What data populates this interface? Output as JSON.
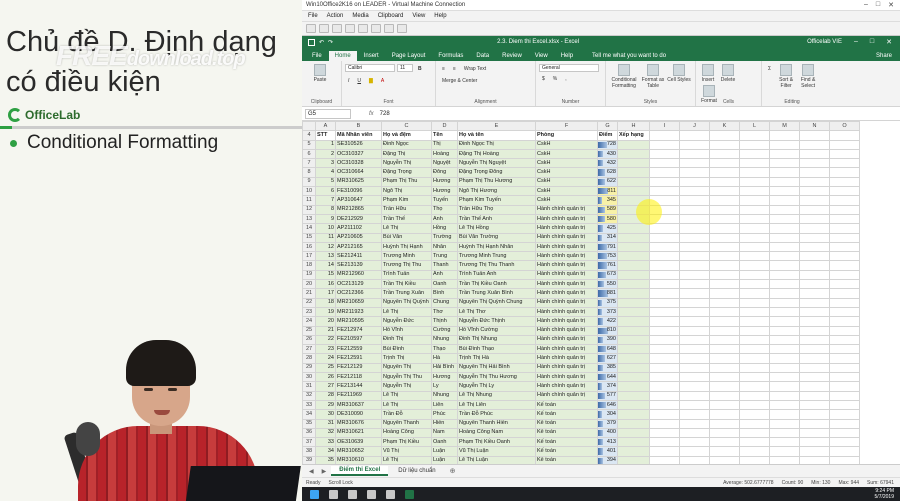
{
  "slide": {
    "title": "Chủ đề D. Định dạng có điều kiện",
    "watermark_1": "FREE",
    "watermark_2": "download.top",
    "logo_text": "OfficeLab",
    "bullet": "Conditional Formatting"
  },
  "vm": {
    "title": "Win10Office2K16 on LEADER - Virtual Machine Connection",
    "menu": [
      "File",
      "Action",
      "Media",
      "Clipboard",
      "View",
      "Help"
    ]
  },
  "excel": {
    "caption": "2.3. Diem thi Excel.xlsx - Excel",
    "user": "Officelab VIE",
    "tabs": [
      "File",
      "Home",
      "Insert",
      "Page Layout",
      "Formulas",
      "Data",
      "Review",
      "View",
      "Help"
    ],
    "active_tab": "Home",
    "tell_me": "Tell me what you want to do",
    "share": "Share",
    "ribbon": {
      "clipboard": {
        "label": "Clipboard",
        "paste": "Paste"
      },
      "font": {
        "label": "Font",
        "font_name": "Calibri",
        "font_size": "11"
      },
      "alignment": {
        "label": "Alignment",
        "wrap": "Wrap Text",
        "merge": "Merge & Center"
      },
      "number": {
        "label": "Number",
        "format": "General"
      },
      "styles": {
        "label": "Styles",
        "cond": "Conditional Formatting",
        "table": "Format as Table",
        "cell": "Cell Styles"
      },
      "cells": {
        "label": "Cells",
        "insert": "Insert",
        "delete": "Delete",
        "format": "Format"
      },
      "editing": {
        "label": "Editing",
        "sort": "Sort & Filter",
        "find": "Find & Select"
      }
    },
    "namebox": "G5",
    "fx": "fx",
    "formula": "728",
    "columns": [
      "A",
      "B",
      "C",
      "D",
      "E",
      "F",
      "G",
      "H",
      "I",
      "J",
      "K",
      "L",
      "M",
      "N",
      "O"
    ],
    "header_row": {
      "row": "4",
      "cells": [
        "STT",
        "Mã Nhân viên",
        "Họ và đệm",
        "Tên",
        "Họ và tên",
        "Phòng",
        "Điểm",
        "Xếp hạng"
      ]
    },
    "rows": [
      [
        "5",
        "1",
        "SE310526",
        "Đinh Ngọc",
        "Thị",
        "Đinh Ngọc Thị",
        "CskH",
        "728"
      ],
      [
        "6",
        "2",
        "OC310327",
        "Đặng Thị",
        "Hoàng",
        "Đặng Thị Hoàng",
        "CskH",
        "430"
      ],
      [
        "7",
        "3",
        "OC310328",
        "Nguyễn Thị",
        "Nguyệt",
        "Nguyễn Thị Nguyệt",
        "CskH",
        "432"
      ],
      [
        "8",
        "4",
        "OC310664",
        "Đặng Trọng",
        "Đông",
        "Đặng Trọng Đông",
        "CskH",
        "628"
      ],
      [
        "9",
        "5",
        "MR310625",
        "Phạm Thị Thu",
        "Hương",
        "Phạm Thị Thu Hương",
        "CskH",
        "622"
      ],
      [
        "10",
        "6",
        "FE310096",
        "Ngô Thị",
        "Hương",
        "Ngô Thị Hương",
        "CskH",
        "811"
      ],
      [
        "11",
        "7",
        "AP310647",
        "Phạm Kim",
        "Tuyến",
        "Phạm Kim Tuyến",
        "CskH",
        "345"
      ],
      [
        "12",
        "8",
        "MR212865",
        "Trần Hữu",
        "Thọ",
        "Trần Hữu Thọ",
        "Hành chính quản trị",
        "589"
      ],
      [
        "13",
        "9",
        "DE212929",
        "Trần Thế",
        "Anh",
        "Trần Thế Anh",
        "Hành chính quản trị",
        "580"
      ],
      [
        "14",
        "10",
        "AP211102",
        "Lê Thị",
        "Hồng",
        "Lê Thị Hồng",
        "Hành chính quản trị",
        "425"
      ],
      [
        "15",
        "11",
        "AP210605",
        "Bùi Văn",
        "Trường",
        "Bùi Văn Trường",
        "Hành chính quản trị",
        "314"
      ],
      [
        "16",
        "12",
        "AP212165",
        "Huỳnh Thị Hạnh",
        "Nhân",
        "Huỳnh Thị Hạnh Nhân",
        "Hành chính quản trị",
        "791"
      ],
      [
        "17",
        "13",
        "SE212411",
        "Trương Minh",
        "Trung",
        "Trương Minh Trung",
        "Hành chính quản trị",
        "753"
      ],
      [
        "18",
        "14",
        "SE213139",
        "Trương Thị Thu",
        "Thanh",
        "Trương Thị Thu Thanh",
        "Hành chính quản trị",
        "761"
      ],
      [
        "19",
        "15",
        "MR212960",
        "Trình Tuấn",
        "Anh",
        "Trình Tuấn Anh",
        "Hành chính quản trị",
        "673"
      ],
      [
        "20",
        "16",
        "OC213129",
        "Trần Thị Kiều",
        "Oanh",
        "Trần Thị Kiều Oanh",
        "Hành chính quản trị",
        "550"
      ],
      [
        "21",
        "17",
        "OC212366",
        "Trần Trung Xuân",
        "Bình",
        "Trần Trung Xuân Bình",
        "Hành chính quản trị",
        "881"
      ],
      [
        "22",
        "18",
        "MR210659",
        "Nguyễn Thị Quỳnh",
        "Chung",
        "Nguyễn Thị Quỳnh Chung",
        "Hành chính quản trị",
        "375"
      ],
      [
        "23",
        "19",
        "MR211923",
        "Lê Thị",
        "Thơ",
        "Lê Thị Thơ",
        "Hành chính quản trị",
        "373"
      ],
      [
        "24",
        "20",
        "MR210595",
        "Nguyễn Đức",
        "Thịnh",
        "Nguyễn Đức Thịnh",
        "Hành chính quản trị",
        "422"
      ],
      [
        "25",
        "21",
        "FE212974",
        "Hồ Vĩnh",
        "Cường",
        "Hồ Vĩnh Cường",
        "Hành chính quản trị",
        "810"
      ],
      [
        "26",
        "22",
        "FE210597",
        "Đinh Thị",
        "Nhung",
        "Đinh Thị Nhung",
        "Hành chính quản trị",
        "390"
      ],
      [
        "27",
        "23",
        "FE212559",
        "Bùi Đình",
        "Thạo",
        "Bùi Đình Thạo",
        "Hành chính quản trị",
        "648"
      ],
      [
        "28",
        "24",
        "FE212591",
        "Trịnh Thị",
        "Hà",
        "Trịnh Thị Hà",
        "Hành chính quản trị",
        "627"
      ],
      [
        "29",
        "25",
        "FE212129",
        "Nguyễn Thị",
        "Hải Bình",
        "Nguyễn Thị Hải Bình",
        "Hành chính quản trị",
        "385"
      ],
      [
        "30",
        "26",
        "FE212118",
        "Nguyễn Thị Thu",
        "Hương",
        "Nguyễn Thị Thu Hương",
        "Hành chính quản trị",
        "644"
      ],
      [
        "31",
        "27",
        "FE213144",
        "Nguyễn Thị",
        "Ly",
        "Nguyễn Thị Ly",
        "Hành chính quản trị",
        "374"
      ],
      [
        "32",
        "28",
        "FE211969",
        "Lê Thị",
        "Nhung",
        "Lê Thị Nhung",
        "Hành chính quản trị",
        "577"
      ],
      [
        "33",
        "29",
        "MR310637",
        "Lê Thị",
        "Liên",
        "Lê Thị Liên",
        "Kế toán",
        "646"
      ],
      [
        "34",
        "30",
        "DE310090",
        "Trần Đỗ",
        "Phúc",
        "Trần Đỗ Phúc",
        "Kế toán",
        "304"
      ],
      [
        "35",
        "31",
        "MR310676",
        "Nguyễn Thanh",
        "Hiền",
        "Nguyễn Thanh Hiền",
        "Kế toán",
        "379"
      ],
      [
        "36",
        "32",
        "MR310621",
        "Hoàng Công",
        "Nam",
        "Hoàng Công Nam",
        "Kế toán",
        "400"
      ],
      [
        "37",
        "33",
        "OE310639",
        "Phạm Thị Kiều",
        "Oanh",
        "Phạm Thị Kiều Oanh",
        "Kế toán",
        "413"
      ],
      [
        "38",
        "34",
        "MR310652",
        "Vũ Thị",
        "Luận",
        "Vũ Thị Luận",
        "Kế toán",
        "401"
      ],
      [
        "39",
        "35",
        "MR310610",
        "Lê Thị",
        "Luận",
        "Lê Thị Luận",
        "Kế toán",
        "394"
      ]
    ],
    "sheet_tabs": [
      "Điểm thi Excel",
      "Dữ liệu chuẩn"
    ],
    "active_sheet": "Điểm thi Excel",
    "status": {
      "ready": "Ready",
      "scroll_lock": "Scroll Lock",
      "average": "Average: 502.6777778",
      "count": "Count: 90",
      "min": "Min: 130",
      "max": "Max: 944",
      "sum": "Sum: 67941"
    },
    "clock": {
      "time": "9:24 PM",
      "date": "5/7/2019"
    }
  }
}
